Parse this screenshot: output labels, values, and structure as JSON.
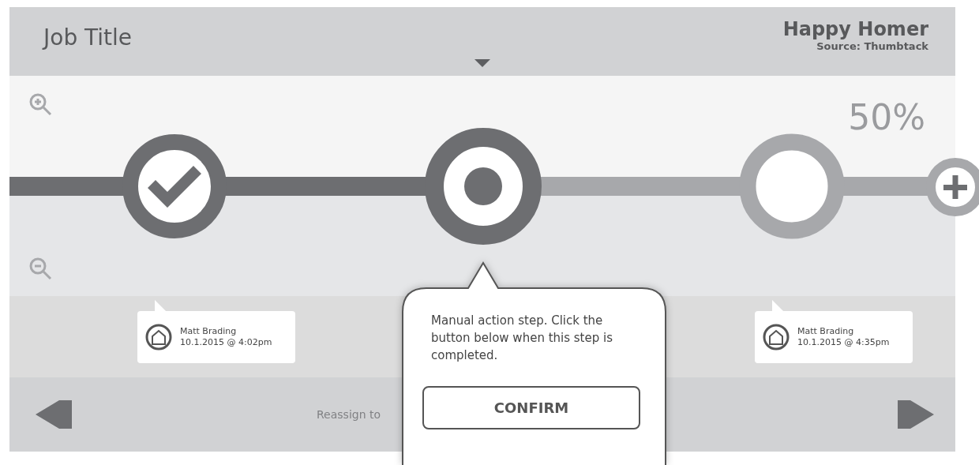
{
  "header": {
    "title": "Job Title",
    "customer": "Happy Homer",
    "source": "Source: Thumbtack"
  },
  "progress": {
    "percent": "50%"
  },
  "steps": [
    {
      "kind": "done",
      "note": {
        "name": "Matt Brading",
        "time": "10.1.2015 @ 4:02pm"
      }
    },
    {
      "kind": "current"
    },
    {
      "kind": "pending",
      "note": {
        "name": "Matt Brading",
        "time": "10.1.2015 @ 4:35pm"
      }
    }
  ],
  "popover": {
    "text": "Manual action step. Click the button below when this step is completed.",
    "button": "CONFIRM"
  },
  "footer": {
    "reassign": "Reassign to"
  }
}
